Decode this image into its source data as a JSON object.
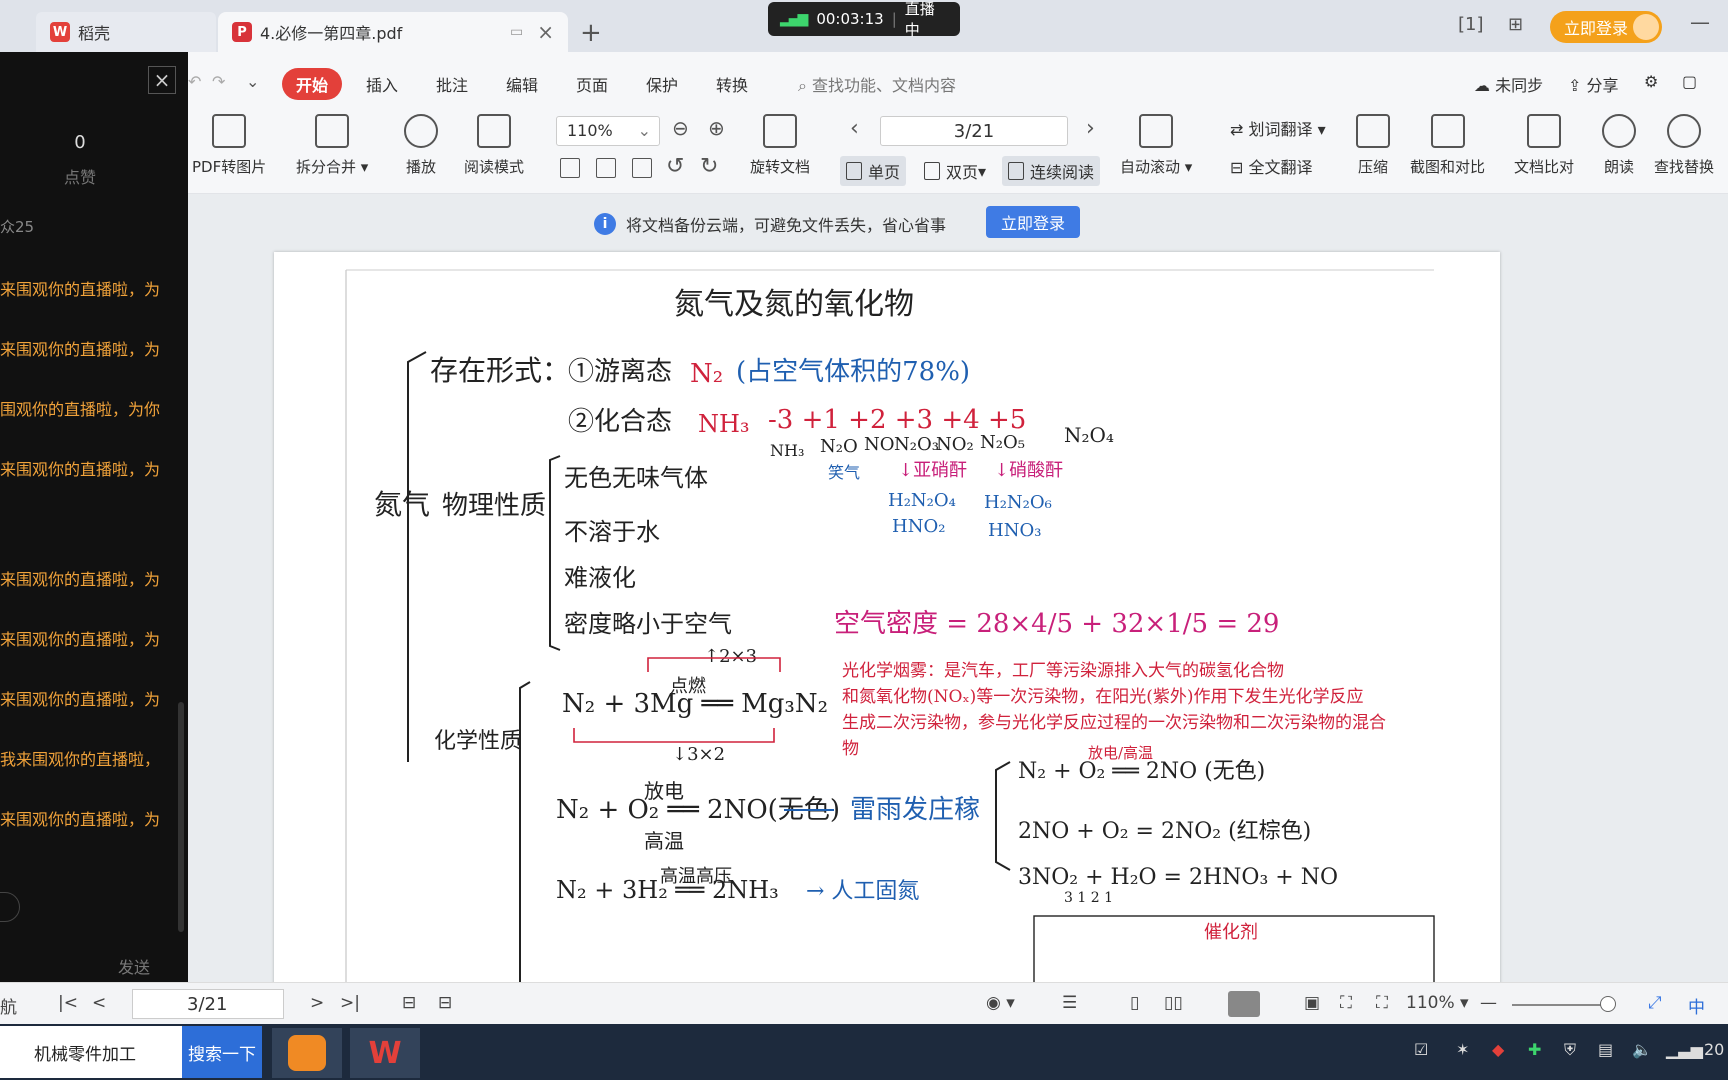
{
  "tabs": {
    "inactive_label": "稻壳",
    "active_label": "4.必修一第四章.pdf",
    "new_tab": "+"
  },
  "live": {
    "timer": "00:03:13",
    "status": "直播中"
  },
  "header": {
    "login_button": "立即登录",
    "page_mode": "1"
  },
  "menu": {
    "items": [
      "开始",
      "插入",
      "批注",
      "编辑",
      "页面",
      "保护",
      "转换"
    ],
    "search_placeholder": "查找功能、文档内容",
    "sync": "未同步",
    "share": "分享"
  },
  "toolbar": {
    "pdf_to_image": "PDF转图片",
    "split_merge": "拆分合并",
    "play": "播放",
    "read_mode": "阅读模式",
    "zoom": "110%",
    "page": "3/21",
    "rotate": "旋转文档",
    "single": "单页",
    "double": "双页",
    "continuous": "连续阅读",
    "auto_scroll": "自动滚动",
    "word_translate": "划词翻译",
    "full_translate": "全文翻译",
    "compress": "压缩",
    "screenshot_compare": "截图和对比",
    "doc_compare": "文档比对",
    "read_aloud": "朗读",
    "find_replace": "查找替换"
  },
  "notice": {
    "text": "将文档备份云端，可避免文件丢失，省心省事",
    "button": "立即登录"
  },
  "document": {
    "title": "氮气及氮的氧化物",
    "main_node": "氮气",
    "existence_label": "存在形式：",
    "free_state": "①游离态",
    "free_formula": "N₂",
    "free_note": "(占空气体积的78%)",
    "compound_state": "②化合态",
    "compound_formula": "NH₃",
    "valences": "-3  +1  +2 +3 +4 +5",
    "species": [
      "NH₃",
      "N₂O",
      "NO",
      "N₂O₃",
      "NO₂",
      "N₂O₅",
      "N₂O₄"
    ],
    "laughing_gas": "笑气",
    "acid_anhydride_1": "↓亚硝酐",
    "acid_anhydride_2": "↓硝酸酐",
    "acid_1": "H₂N₂O₄",
    "acid_1b": "HNO₂",
    "acid_2": "H₂N₂O₆",
    "acid_2b": "HNO₃",
    "physical_label": "物理性质",
    "physical_props": [
      "无色无味气体",
      "不溶于水",
      "难液化",
      "密度略小于空气"
    ],
    "air_density": "空气密度 = 28×4/5 + 32×1/5 = 29",
    "smog_text": [
      "光化学烟雾：是汽车，工厂等污染源排入大气的碳氢化合物",
      "和氮氧化物(NOₓ)等一次污染物，在阳光(紫外)作用下发生光化学反应",
      "生成二次污染物，参与光化学反应过程的一次污染物和二次污染物的混合",
      "物"
    ],
    "chemical_label": "化学性质",
    "eq_mg": "N₂ + 3Mg ══ Mg₃N₂",
    "eq_mg_cond": "点燃",
    "eq_mg_top": "↑2×3",
    "eq_mg_bottom": "↓3×2",
    "eq_o2": "N₂ + O₂ ══ 2NO(无色)",
    "eq_o2_cond1": "放电",
    "eq_o2_cond2": "高温",
    "lightning": "雷雨发庄稼",
    "eq_h2": "N₂ + 3H₂ ══ 2NH₃",
    "eq_h2_cond": "高温高压",
    "nitrogen_fixation": "→ 人工固氮",
    "right_eq1": "N₂ + O₂ ══ 2NO (无色)",
    "right_eq1_cond": "放电/高温",
    "right_eq2": "2NO + O₂ = 2NO₂ (红棕色)",
    "right_eq3": "3NO₂ + H₂O = 2HNO₃ + NO",
    "right_eq3_ratio": "3 1 2 1",
    "bottom_box": "催化剂"
  },
  "chat": {
    "likes": "0",
    "likes_label": "点赞",
    "viewer_count": "众25",
    "messages": [
      "来围观你的直播啦，为",
      "来围观你的直播啦，为",
      "围观你的直播啦，为你",
      "来围观你的直播啦，为",
      "来围观你的直播啦，为",
      "来围观你的直播啦，为",
      "来围观你的直播啦，为",
      "我来围观你的直播啦，",
      "来围观你的直播啦，为"
    ],
    "send": "发送"
  },
  "statusbar": {
    "nav_label": "航",
    "page": "3/21",
    "zoom": "110%",
    "ime": "中"
  },
  "taskbar": {
    "search_text": "机械零件加工",
    "search_button": "搜索一下",
    "clock_fragment": "20"
  },
  "colors": {
    "accent_red": "#e3403a",
    "brand_blue": "#3f7be4",
    "login_orange": "#f4a11b",
    "ink_black": "#222222",
    "ink_red": "#d0223c",
    "ink_blue": "#1f5fb0",
    "ink_magenta": "#c8207a"
  }
}
